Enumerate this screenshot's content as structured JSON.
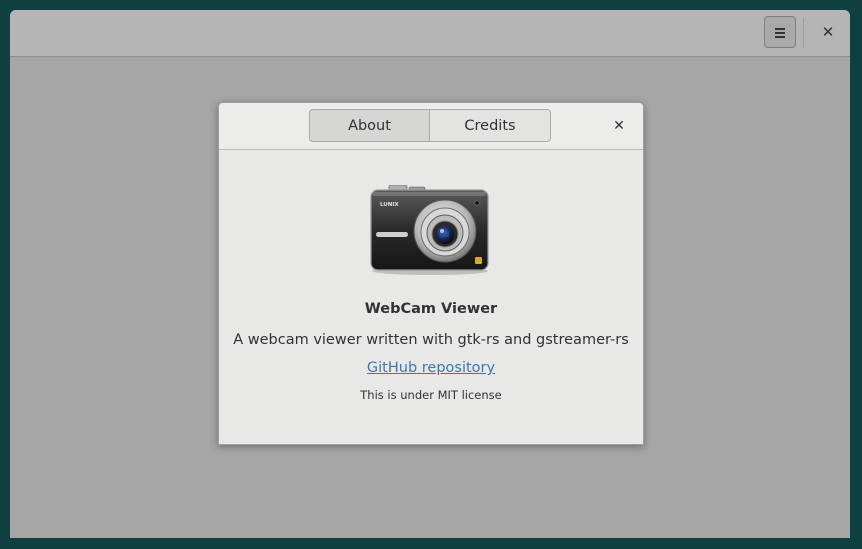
{
  "window": {
    "menu_icon": "hamburger-menu-icon",
    "close_glyph": "✕"
  },
  "dialog": {
    "tabs": [
      {
        "label": "About",
        "active": true
      },
      {
        "label": "Credits",
        "active": false
      }
    ],
    "close_glyph": "✕",
    "app_icon": "camera-icon",
    "camera_brand": "LUNIX",
    "app_name": "WebCam Viewer",
    "description": "A webcam viewer written with gtk-rs and gstreamer-rs",
    "link_text": "GitHub repository",
    "license_text": "This is under MIT license"
  }
}
